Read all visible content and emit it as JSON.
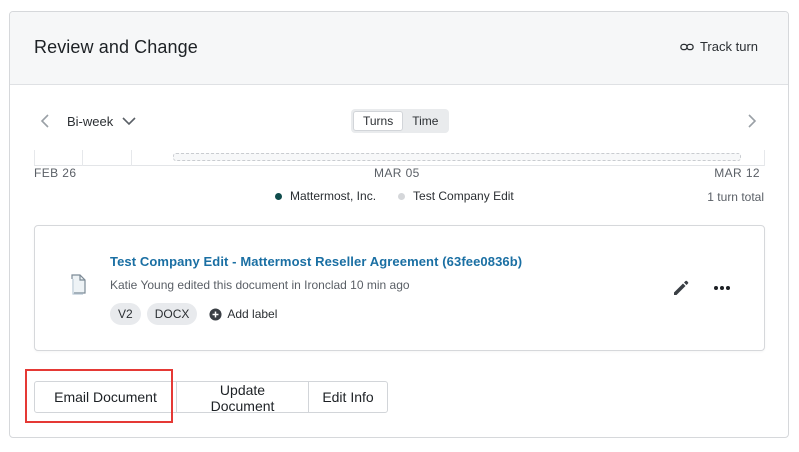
{
  "panel": {
    "title": "Review and Change",
    "track_label": "Track turn"
  },
  "timeline": {
    "period": "Bi-week",
    "toggle": [
      {
        "label": "Turns",
        "active": true
      },
      {
        "label": "Time",
        "active": false
      }
    ],
    "dates": {
      "start": "FEB 26",
      "middle": "MAR 05",
      "end": "MAR 12"
    },
    "legend": [
      {
        "label": "Mattermost, Inc.",
        "color": "#0f4c4c"
      },
      {
        "label": "Test Company Edit",
        "color": "#d5d7da"
      }
    ],
    "total": "1 turn total"
  },
  "document": {
    "title": "Test Company Edit - Mattermost Reseller Agreement (63fee0836b)",
    "meta": "Katie Young edited this document in Ironclad 10 min ago",
    "chips": [
      "V2",
      "DOCX"
    ],
    "add_label": "Add label",
    "icon": "document-icon"
  },
  "actions": {
    "email": "Email Document",
    "update": "Update Document",
    "edit_info": "Edit Info"
  },
  "colors": {
    "link": "#1a6fa3",
    "highlight": "#e53935"
  }
}
